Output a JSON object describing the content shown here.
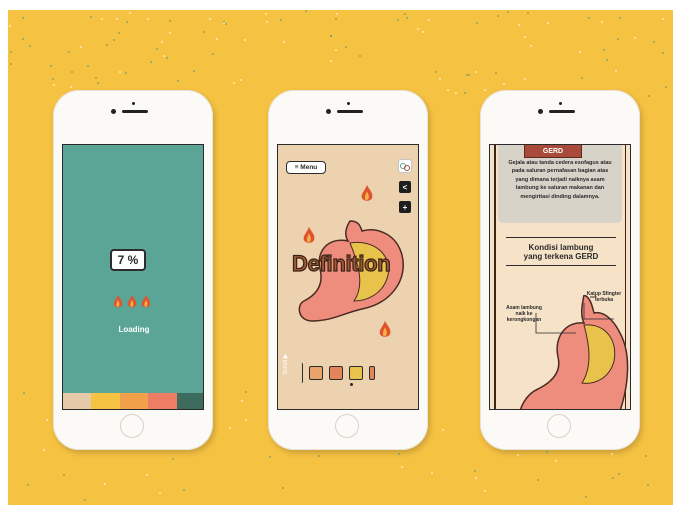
{
  "colors": {
    "background": "#f6c242",
    "screen1_bg": "#5aa596",
    "screen2_bg": "#ecd2ae",
    "screen3_bg": "#f5e2c7",
    "accent_red": "#a84b3a",
    "stomach_pink": "#ee8d7e",
    "stomach_yellow": "#e8c34b"
  },
  "screen1": {
    "progress_label": "7 %",
    "loading_label": "Loading",
    "flame_icons": [
      "flame-icon",
      "flame-icon",
      "flame-icon"
    ],
    "palette": [
      "#e6c9a8",
      "#f6c242",
      "#f3a04a",
      "#ee7d66",
      "#3d6b5e"
    ]
  },
  "screen2": {
    "menu_label": "≡ Menu",
    "title": "Definition",
    "scroll_label": "Scroll ▶",
    "icons": [
      "logo-icon",
      "share-icon",
      "plus-icon",
      "flame-icon"
    ]
  },
  "screen3": {
    "card_title": "GERD",
    "card_text": "Gejala atau tanda cedera esofagus atau pada saluran pernafasan bagian atas yang dimana terjadi naiknya asam lambung ke saluran makanan dan mengiritasi dinding dalamnya.",
    "section_title_line1": "Kondisi lambung",
    "section_title_line2": "yang terkena GERD",
    "label_katup": "Katup Sfingter terbuka",
    "label_asam": "Asam lambung naik ke kerongkongan"
  }
}
